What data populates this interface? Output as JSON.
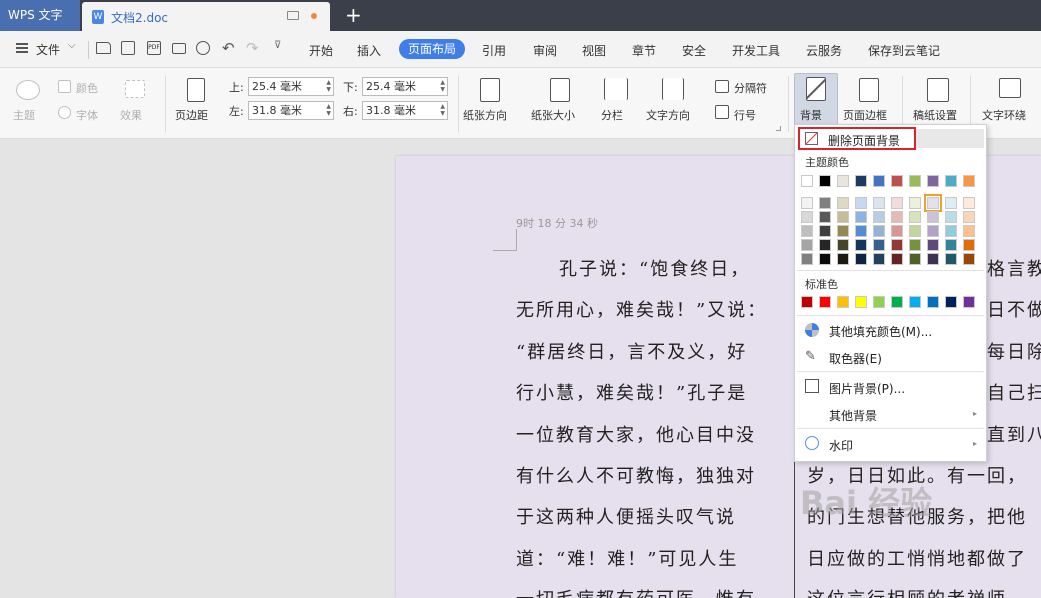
{
  "app": {
    "name": "WPS 文字"
  },
  "document": {
    "tab_title": "文档2.doc",
    "tab_icon_letter": "W"
  },
  "menubar": {
    "file_label": "文件",
    "items": [
      "开始",
      "插入",
      "页面布局",
      "引用",
      "审阅",
      "视图",
      "章节",
      "安全",
      "开发工具",
      "云服务",
      "保存到云笔记"
    ],
    "active_index": 2
  },
  "ribbon": {
    "theme_label": "主题",
    "color_label": "颜色",
    "font_label": "字体",
    "effect_label": "效果",
    "margin_label": "页边距",
    "top_label": "上:",
    "top_value": "25.4 毫米",
    "bottom_label": "下:",
    "bottom_value": "25.4 毫米",
    "left_label": "左:",
    "left_value": "31.8 毫米",
    "right_label": "右:",
    "right_value": "31.8 毫米",
    "orientation_label": "纸张方向",
    "size_label": "纸张大小",
    "columns_label": "分栏",
    "text_direction_label": "文字方向",
    "separator_label": "分隔符",
    "line_number_label": "行号",
    "background_label": "背景",
    "page_border_label": "页面边框",
    "manuscript_label": "稿纸设置",
    "text_wrap_label": "文字环绕"
  },
  "page": {
    "timestamp": "9时 18 分 34 秒",
    "left_column_lines": [
      "孔子说：“饱食终日，",
      "无所用心，难矣哉！”又说：",
      "“群居终日，言不及义，好",
      "行小慧，难矣哉！”孔子是",
      "一位教育大家，他心目中没",
      "有什么人不可教悔，独独对",
      "于这两种人便摇头叹气说",
      "道：“难！难！”可见人生",
      "一切毛病都有药可医，惟有"
    ],
    "right_column_lines": [
      "格言教",
      "日不做事",
      "每日除",
      "自己扫地",
      "直到八",
      "岁，日日如此。有一回，",
      "的门生想替他服务，把他",
      "日应做的工悄悄地都做了",
      "这位言行相顾的老禅师"
    ]
  },
  "dropdown": {
    "remove_label": "删除页面背景",
    "theme_colors_label": "主题颜色",
    "standard_colors_label": "标准色",
    "more_fill_label": "其他填充颜色(M)...",
    "eyedropper_label": "取色器(E)",
    "picture_bg_label": "图片背景(P)...",
    "other_bg_label": "其他背景",
    "watermark_label": "水印",
    "theme_top_row": [
      "#ffffff",
      "#000000",
      "#e8e6dc",
      "#1f3864",
      "#4472c4",
      "#c0504d",
      "#9bbb59",
      "#8064a2",
      "#4bacc6",
      "#f79646"
    ],
    "theme_shades": [
      [
        "#f2f2f2",
        "#7f7f7f",
        "#ddd9c3",
        "#c6d9f0",
        "#dbe5f1",
        "#f2dcdb",
        "#ebf1dd",
        "#e5e0ec",
        "#dbeef3",
        "#fdeada"
      ],
      [
        "#d8d8d8",
        "#595959",
        "#c4bd97",
        "#8db3e2",
        "#b8cce4",
        "#e5b9b7",
        "#d7e3bc",
        "#ccc1d9",
        "#b7dde8",
        "#fbd5b5"
      ],
      [
        "#bfbfbf",
        "#3f3f3f",
        "#938953",
        "#548dd4",
        "#95b3d7",
        "#d99694",
        "#c3d69b",
        "#b2a2c7",
        "#92cddc",
        "#fac08f"
      ],
      [
        "#a5a5a5",
        "#262626",
        "#494429",
        "#17365d",
        "#366092",
        "#953734",
        "#76923c",
        "#5f497a",
        "#31859b",
        "#e36c09"
      ],
      [
        "#7f7f7f",
        "#0c0c0c",
        "#1d1b10",
        "#0f243e",
        "#244061",
        "#632423",
        "#4f6128",
        "#3f3151",
        "#205867",
        "#974806"
      ]
    ],
    "standard_colors": [
      "#c00000",
      "#ff0000",
      "#ffc000",
      "#ffff00",
      "#92d050",
      "#00b050",
      "#00b0f0",
      "#0070c0",
      "#002060",
      "#7030a0"
    ]
  },
  "watermark_text": "Bai 经验",
  "colors": {
    "accent": "#3f7ee8",
    "highlight_border": "#d9232d",
    "page_bg": "#e6e0ee"
  }
}
